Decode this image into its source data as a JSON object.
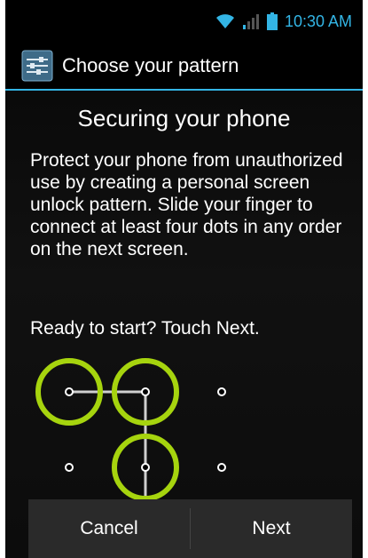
{
  "status_bar": {
    "time": "10:30 AM",
    "icons": [
      "wifi-icon",
      "signal-icon",
      "battery-icon"
    ],
    "accent_color": "#33b5e5"
  },
  "action_bar": {
    "title": "Choose your pattern",
    "icon": "settings-sliders-icon"
  },
  "content": {
    "title": "Securing your phone",
    "description": "Protect your phone from unauthorized use by creating a personal screen unlock pattern. Slide your finger to connect at least four dots in any order on the next screen.",
    "prompt": "Ready to start? Touch Next."
  },
  "pattern_preview": {
    "highlight_color": "#a6d40e",
    "grid": "3x3",
    "selected_dots": [
      "row1-col1",
      "row1-col2",
      "row2-col2"
    ]
  },
  "bottom_bar": {
    "cancel_label": "Cancel",
    "next_label": "Next"
  }
}
